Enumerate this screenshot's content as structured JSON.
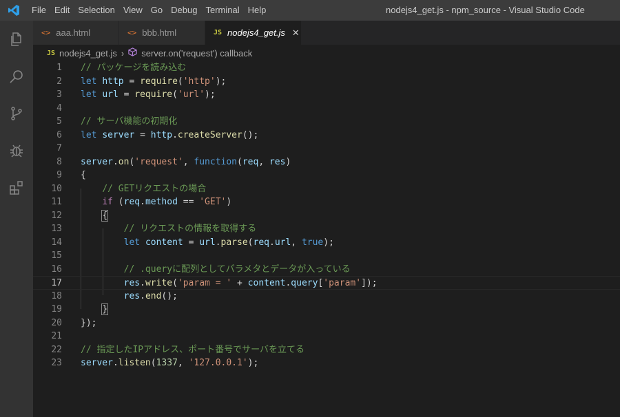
{
  "titlebar": {
    "menu": [
      "File",
      "Edit",
      "Selection",
      "View",
      "Go",
      "Debug",
      "Terminal",
      "Help"
    ],
    "window_title": "nodejs4_get.js - npm_source - Visual Studio Code"
  },
  "activity_bar": {
    "icons": [
      "explorer-icon",
      "search-icon",
      "source-control-icon",
      "debug-icon",
      "extensions-icon"
    ]
  },
  "tabs": [
    {
      "label": "aaa.html",
      "icon": "html-icon"
    },
    {
      "label": "bbb.html",
      "icon": "html-icon"
    },
    {
      "label": "nodejs4_get.js",
      "icon": "js-icon",
      "active": true
    }
  ],
  "tab_icon_text": {
    "html": "<>",
    "js": "JS",
    "close": "✕"
  },
  "breadcrumb": {
    "file": "nodejs4_get.js",
    "symbol": "server.on('request') callback"
  },
  "editor": {
    "line_numbers": [
      "1",
      "2",
      "3",
      "4",
      "5",
      "6",
      "7",
      "8",
      "9",
      "10",
      "11",
      "12",
      "13",
      "14",
      "15",
      "16",
      "17",
      "18",
      "19",
      "20",
      "21",
      "22",
      "23"
    ],
    "lines": [
      "// パッケージを読み込む",
      "let http = require('http');",
      "let url = require('url');",
      "",
      "// サーバ機能の初期化",
      "let server = http.createServer();",
      "",
      "server.on('request', function(req, res)",
      "{",
      "    // GETリクエストの場合",
      "    if (req.method == 'GET')",
      "    {",
      "        // リクエストの情報を取得する",
      "        let content = url.parse(req.url, true);",
      "",
      "        // .queryに配列としてパラメタとデータが入っている",
      "        res.write('param = ' + content.query['param']);",
      "        res.end();",
      "    }",
      "});",
      "",
      "// 指定したIPアドレス、ポート番号でサーバを立てる",
      "server.listen(1337, '127.0.0.1');"
    ]
  },
  "colors": {
    "comment": "#6a9955",
    "keyword": "#569cd6",
    "control": "#c586c0",
    "variable": "#9cdcfe",
    "function": "#dcdcaa",
    "string": "#ce9178",
    "number": "#b5cea8"
  }
}
